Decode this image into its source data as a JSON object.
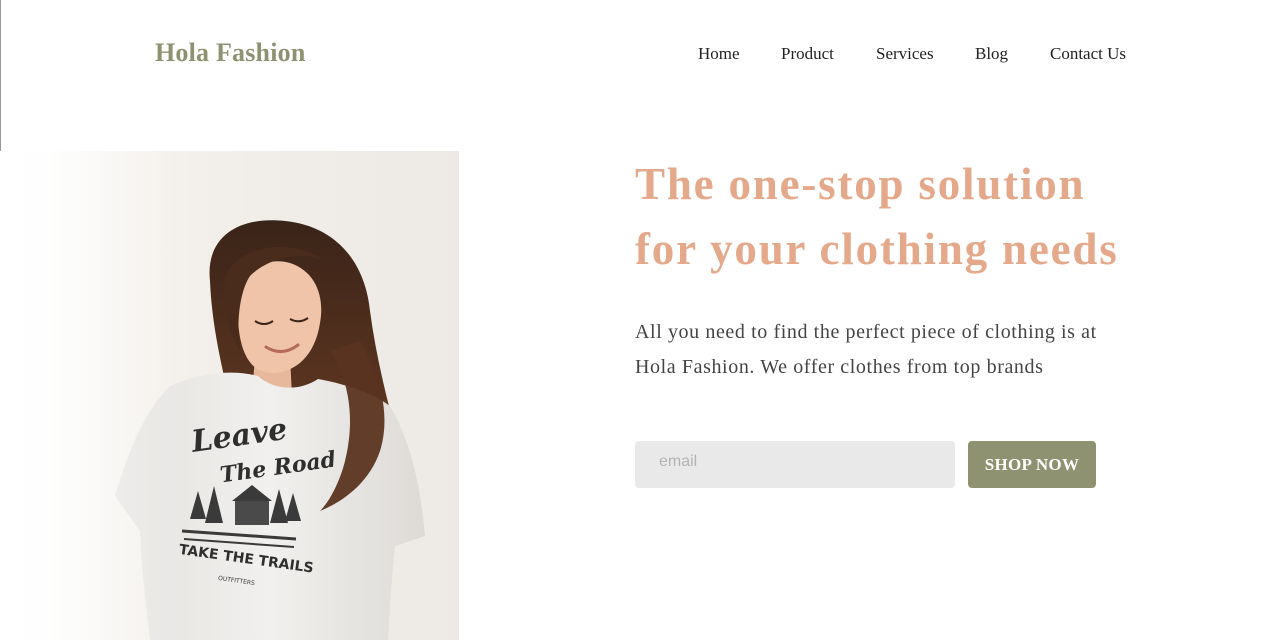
{
  "brand": {
    "logo_text": "Hola Fashion",
    "logo_color": "#8f9270"
  },
  "nav": {
    "items": [
      {
        "label": "Home"
      },
      {
        "label": "Product"
      },
      {
        "label": "Services"
      },
      {
        "label": "Blog"
      },
      {
        "label": "Contact Us"
      }
    ]
  },
  "hero": {
    "headline_line1": "The one-stop solution",
    "headline_line2": "for your clothing needs",
    "headline_color": "#e4a88a",
    "description_line1": "All you need to find the perfect piece of clothing is at",
    "description_line2": "Hola Fashion. We offer clothes from top brands",
    "image": {
      "shirt_print_line1": "Leave",
      "shirt_print_line2": "The Road",
      "shirt_print_line3": "TAKE THE TRAILS",
      "shirt_print_line4": "OUTFITTERS"
    }
  },
  "form": {
    "email_placeholder": "email",
    "email_value": "",
    "button_label": "SHOP NOW",
    "button_color": "#8f9270"
  }
}
